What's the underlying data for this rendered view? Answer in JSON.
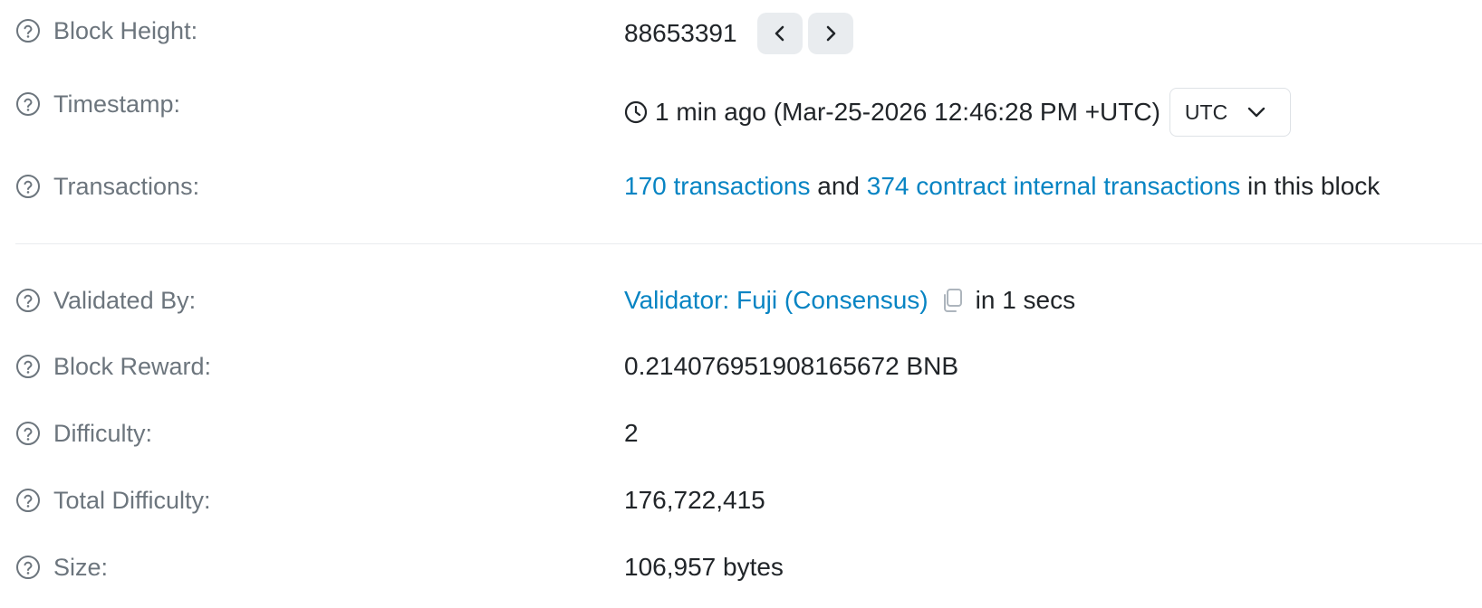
{
  "rows": {
    "block_height": {
      "label": "Block Height:",
      "value": "88653391"
    },
    "timestamp": {
      "label": "Timestamp:",
      "value": "1 min ago (Mar-25-2026 12:46:28 PM +UTC)",
      "timezone": "UTC"
    },
    "transactions": {
      "label": "Transactions:",
      "tx_link": "170 transactions",
      "connector": " and ",
      "internal_link": "374 contract internal transactions",
      "suffix": " in this block"
    },
    "validated_by": {
      "label": "Validated By:",
      "validator_link": "Validator: Fuji (Consensus)",
      "suffix": "in 1 secs"
    },
    "block_reward": {
      "label": "Block Reward:",
      "value": "0.214076951908165672 BNB"
    },
    "difficulty": {
      "label": "Difficulty:",
      "value": "2"
    },
    "total_difficulty": {
      "label": "Total Difficulty:",
      "value": "176,722,415"
    },
    "size": {
      "label": "Size:",
      "value": "106,957 bytes"
    }
  },
  "icons": {
    "help": "question-circle-icon",
    "prev": "chevron-left-icon",
    "next": "chevron-right-icon",
    "clock": "clock-icon",
    "dropdown": "chevron-down-icon",
    "copy": "copy-icon"
  },
  "colors": {
    "label": "#6c757d",
    "value": "#212529",
    "link": "#0784c3",
    "button_bg": "#e9ecef",
    "divider": "#e9ecef"
  }
}
